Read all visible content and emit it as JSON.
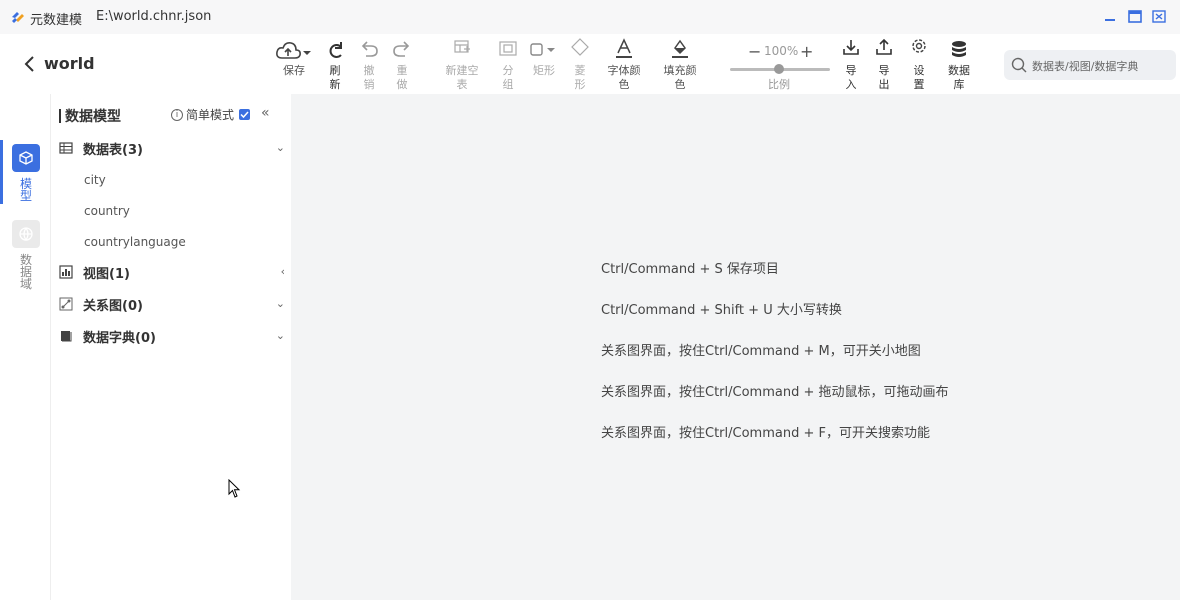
{
  "window": {
    "app_name": "元数建模",
    "file_path": "E:\\world.chnr.json"
  },
  "toolbar": {
    "project_name": "world",
    "save": "保存",
    "refresh": "刷新",
    "undo": "撤销",
    "redo": "重做",
    "new_empty_table": "新建空表",
    "group": "分组",
    "rectangle": "矩形",
    "diamond": "菱形",
    "font_color": "字体颜色",
    "fill_color": "填充颜色",
    "zoom_value": "100%",
    "zoom_label": "比例",
    "import": "导入",
    "export": "导出",
    "settings": "设置",
    "database": "数据库"
  },
  "search": {
    "placeholder": "数据表/视图/数据字典"
  },
  "rail": {
    "model": "模型",
    "data_domain": "数据域"
  },
  "panel": {
    "title": "数据模型",
    "simple_mode": "简单模式",
    "groups": [
      {
        "label": "数据表(3)",
        "expanded": true,
        "items": [
          "city",
          "country",
          "countrylanguage"
        ]
      },
      {
        "label": "视图(1)",
        "expanded": false,
        "items": []
      },
      {
        "label": "关系图(0)",
        "expanded": true,
        "items": []
      },
      {
        "label": "数据字典(0)",
        "expanded": true,
        "items": []
      }
    ]
  },
  "canvas": {
    "tips": [
      "Ctrl/Command + S 保存项目",
      "Ctrl/Command + Shift + U 大小写转换",
      "关系图界面，按住Ctrl/Command + M，可开关小地图",
      "关系图界面，按住Ctrl/Command + 拖动鼠标，可拖动画布",
      "关系图界面，按住Ctrl/Command + F，可开关搜索功能"
    ]
  },
  "colors": {
    "accent": "#3b6fe0",
    "canvas_bg": "#f3f4f5"
  }
}
